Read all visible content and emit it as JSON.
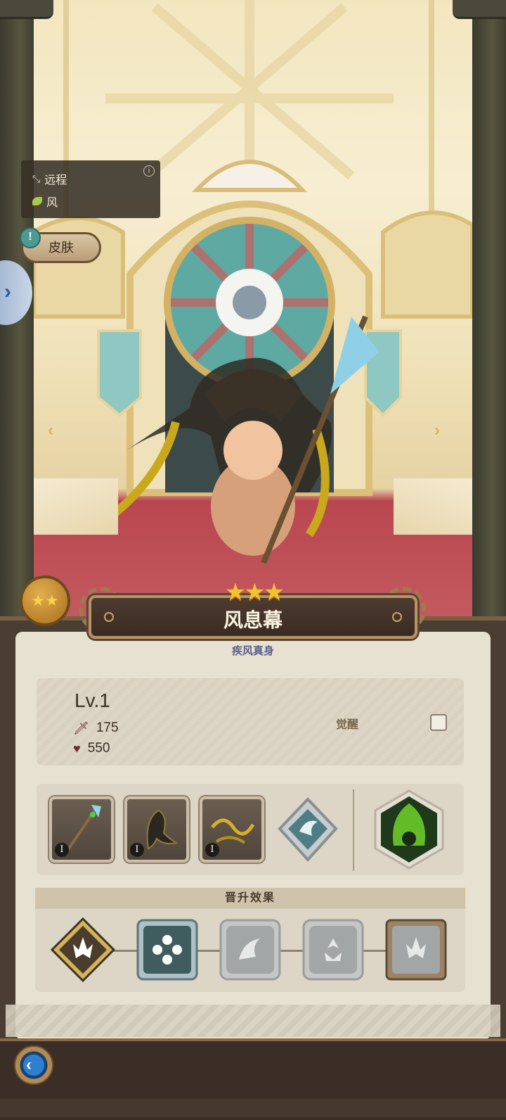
{
  "hero": {
    "name": "风息幕",
    "subtitle": "疾风真身",
    "stars": 3,
    "range_label": "远程",
    "element_label": "风"
  },
  "buttons": {
    "skin_label": "皮肤",
    "skin_alert": "!"
  },
  "stats": {
    "level": "Lv.1",
    "attack": "175",
    "hp": "550",
    "awaken_label": "觉醒"
  },
  "equipment": [
    {
      "name": "trident-weapon",
      "tier": "I"
    },
    {
      "name": "dark-wing-armor",
      "tier": "I"
    },
    {
      "name": "golden-ribbon-accessory",
      "tier": "I"
    }
  ],
  "promotion": {
    "header": "晋升效果"
  },
  "colors": {
    "panel_bg": "#e7e1d1",
    "accent_gold": "#f4c231",
    "nav_blue": "#2f7fd0",
    "carpet_red": "#b44651"
  },
  "icons": [
    "info-icon",
    "bow-icon",
    "wind-leaf-icon",
    "sword-icon",
    "heart-icon",
    "chevron-right-icon",
    "chevron-left-icon",
    "back-arrow-icon"
  ]
}
